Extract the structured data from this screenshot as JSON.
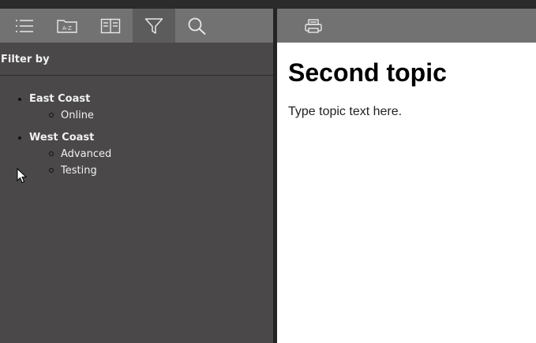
{
  "toolbar": {
    "buttons": [
      {
        "icon": "list-icon",
        "active": false
      },
      {
        "icon": "index-folder-icon",
        "label": "A-Z",
        "active": false
      },
      {
        "icon": "book-icon",
        "active": false
      },
      {
        "icon": "filter-icon",
        "active": true
      },
      {
        "icon": "search-icon",
        "active": false
      }
    ],
    "right_buttons": [
      {
        "icon": "print-icon"
      }
    ]
  },
  "filter_panel": {
    "header": "Filter by",
    "groups": [
      {
        "label": "East Coast",
        "items": [
          "Online"
        ]
      },
      {
        "label": "West Coast",
        "items": [
          "Advanced",
          "Testing"
        ]
      }
    ]
  },
  "topic": {
    "title": "Second topic",
    "body": "Type topic text here."
  },
  "colors": {
    "toolbar": "#727272",
    "toolbar_active": "#5c5c5c",
    "left_pane": "#4a4849",
    "divider": "#242424",
    "content_bg": "#ffffff"
  }
}
